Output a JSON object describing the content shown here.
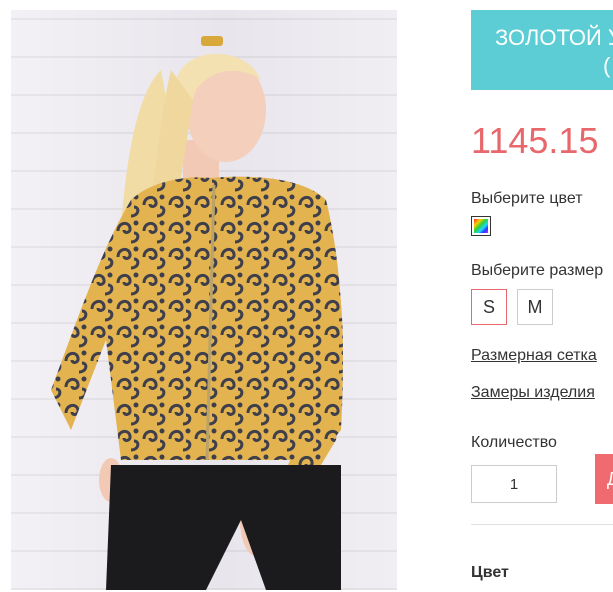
{
  "product": {
    "name_line1": "ЗОЛОТОЙ У",
    "name_line2": "(",
    "price": "1145.15",
    "color_label": "Выберите цвет",
    "size_label": "Выберите размер",
    "sizes": [
      {
        "label": "S",
        "selected": true
      },
      {
        "label": "M",
        "selected": false
      }
    ],
    "size_chart_link": "Размерная сетка",
    "measurements_link": "Замеры изделия",
    "quantity_label": "Количество",
    "quantity_value": "1",
    "buy_button_label": "Д",
    "section_title": "Цвет"
  },
  "colors": {
    "banner": "#5ccdd4",
    "price": "#e8676b",
    "buy_button": "#ef6b6f",
    "selected_size_border": "#e8676b"
  }
}
